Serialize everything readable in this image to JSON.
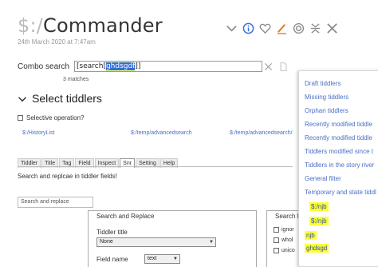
{
  "header": {
    "prefix": "$:/",
    "title": "Commander",
    "subtitle": "24th March 2020 at 7:47am"
  },
  "toolbar": {
    "icons": [
      "chevron-down-icon",
      "info-icon",
      "heart-icon",
      "edit-icon",
      "target-icon",
      "collapse-icon",
      "close-icon"
    ]
  },
  "combo": {
    "label": "Combo search",
    "value_prefix": "[search[",
    "value_selected": "ghdsgdf",
    "value_suffix": "]]",
    "matches": "3 matches"
  },
  "section": {
    "title": "Select tiddlers",
    "selective": "Selective operation?"
  },
  "paths": [
    "$:/HistoryList",
    "$:/temp/advancedsearch",
    "$:/temp/advancedsearch/"
  ],
  "tabs": [
    "Tiddler",
    "Title",
    "Tag",
    "Field",
    "Inspect",
    "Snr",
    "Setting",
    "Help"
  ],
  "active_tab": "Snr",
  "snr": {
    "description": "Search and replcae in tiddler fields!",
    "input_placeholder": "Search and replace"
  },
  "search_replace": {
    "legend": "Search and Replace",
    "tiddler_title_label": "Tiddler title",
    "tiddler_title_value": "None",
    "field_name_label": "Field name",
    "field_name_value": "text"
  },
  "search_flags": {
    "legend": "Search f",
    "options": [
      "ignor",
      "whol",
      "unico"
    ]
  },
  "dropdown": {
    "items": [
      "Draft tiddlers",
      "Missing tiddlers",
      "Orphan tiddlers",
      "Recently modified tiddle",
      "Recently modified tiddle",
      "Tiddlers modified since t",
      "Tiddlers in the story river",
      "General filter",
      "Temporary and state tiddl",
      "$:/njb",
      "$:/njb",
      "njb",
      "ghdsgd"
    ]
  },
  "colors": {
    "link": "#4a6fc4",
    "highlight": "#ffff33",
    "info": "#3b6fe0",
    "edit": "#e07820"
  }
}
